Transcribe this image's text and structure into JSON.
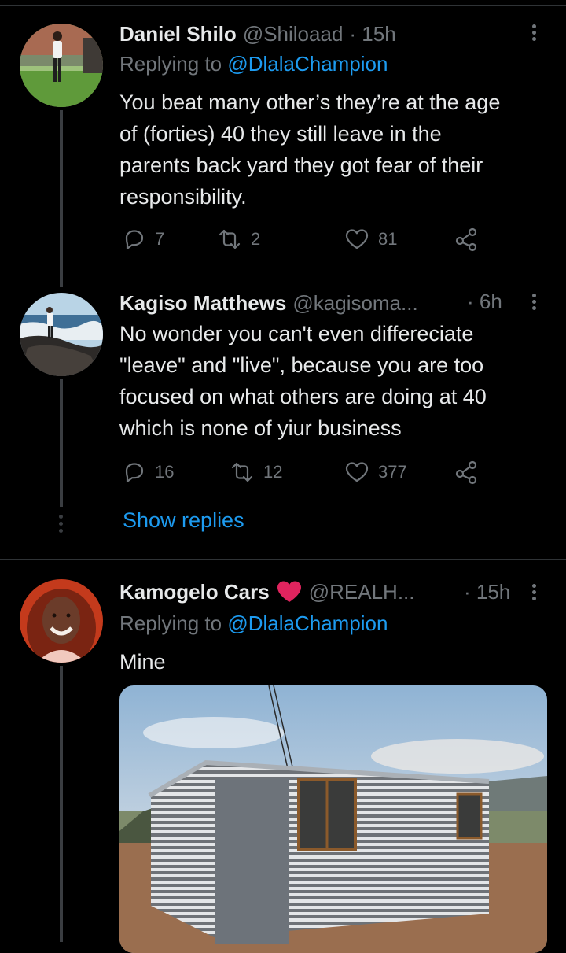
{
  "tweets": [
    {
      "name": "Daniel Shilo",
      "handle": "@Shiloaad",
      "time": "· 15h",
      "replying_prefix": "Replying to",
      "replying_to": "@DlalaChampion",
      "lines": [
        "You beat many other’s they’re at the age",
        "of (forties) 40 they still leave in the",
        "parents back yard they got fear of their",
        "responsibility."
      ],
      "replies": "7",
      "retweets": "2",
      "likes": "81"
    },
    {
      "name": "Kagiso Matthews",
      "handle": "@kagisoma...",
      "time": "· 6h",
      "lines": [
        "No wonder you can't even differeciate",
        "\"leave\" and \"live\", because you are too",
        "focused on what others are doing at 40",
        "which is none of yiur business"
      ],
      "replies": "16",
      "retweets": "12",
      "likes": "377"
    },
    {
      "name": "Kamogelo Cars",
      "handle": "@REALH...",
      "time": "· 15h",
      "replying_prefix": "Replying to",
      "replying_to": "@DlalaChampion",
      "lines": [
        "Mine"
      ]
    }
  ],
  "show_replies_label": "Show replies",
  "colors": {
    "background": "#000000",
    "text": "#e7e9ea",
    "muted": "#71767b",
    "link": "#1d9bf0",
    "heart": "#e0245e"
  }
}
